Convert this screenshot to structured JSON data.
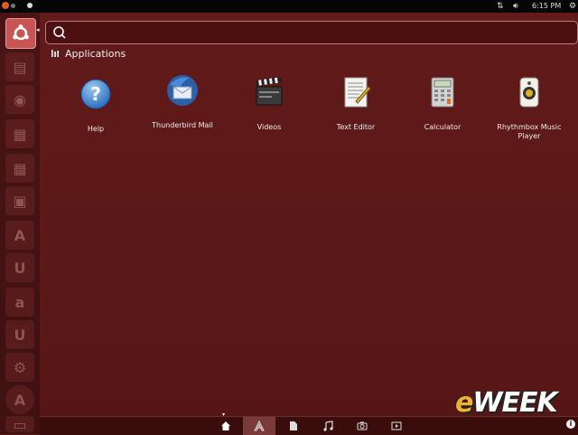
{
  "top_panel": {
    "clock": "6:15 PM"
  },
  "search": {
    "value": "",
    "placeholder": ""
  },
  "section": {
    "title": "Applications"
  },
  "apps": [
    {
      "label": "Help",
      "icon": "help-icon"
    },
    {
      "label": "Thunderbird Mail",
      "icon": "thunderbird-icon"
    },
    {
      "label": "Videos",
      "icon": "clapperboard-icon"
    },
    {
      "label": "Text Editor",
      "icon": "text-editor-icon"
    },
    {
      "label": "Calculator",
      "icon": "calculator-icon"
    },
    {
      "label": "Rhythmbox Music Player",
      "icon": "speaker-icon"
    }
  ],
  "launcher": {
    "items": [
      "ubuntu-logo-icon",
      "files-icon",
      "firefox-icon",
      "writer-icon",
      "calc-icon",
      "impress-icon",
      "software-center-icon",
      "ubuntu-one-icon",
      "amazon-icon",
      "ubuntu-one-music-icon",
      "settings-icon",
      "update-manager-icon",
      "trash-icon"
    ]
  },
  "lenses": [
    "home-icon",
    "applications-icon",
    "files-icon",
    "music-icon",
    "photos-icon",
    "videos-icon"
  ],
  "watermark": {
    "e": "e",
    "rest": "WEEK"
  },
  "colors": {
    "dash_bg": "#5b1717",
    "launcher_active": "#c85454",
    "brand_orange": "#f0b030"
  }
}
